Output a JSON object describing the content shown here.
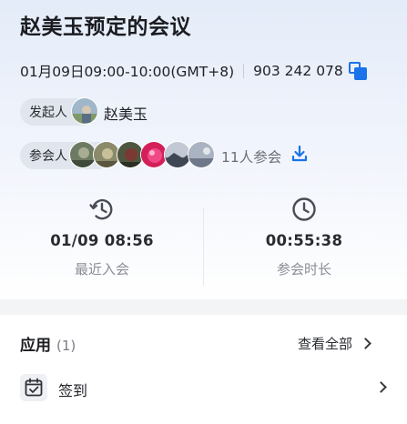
{
  "meeting": {
    "title": "赵美玉预定的会议",
    "time": "01月09日09:00-10:00(GMT+8)",
    "meeting_id": "903 242 078"
  },
  "organizer": {
    "label": "发起人",
    "name": "赵美玉"
  },
  "attendees": {
    "label": "参会人",
    "count_text": "11人参会"
  },
  "stats": {
    "recent_join": {
      "value": "01/09 08:56",
      "label": "最近入会"
    },
    "duration": {
      "value": "00:55:38",
      "label": "参会时长"
    }
  },
  "apps": {
    "title": "应用",
    "count": "(1)",
    "view_all": "查看全部",
    "items": [
      {
        "label": "签到",
        "icon": "calendar-check-icon"
      }
    ]
  },
  "colors": {
    "accent": "#1a73e8",
    "muted_text": "#8a8d94"
  }
}
